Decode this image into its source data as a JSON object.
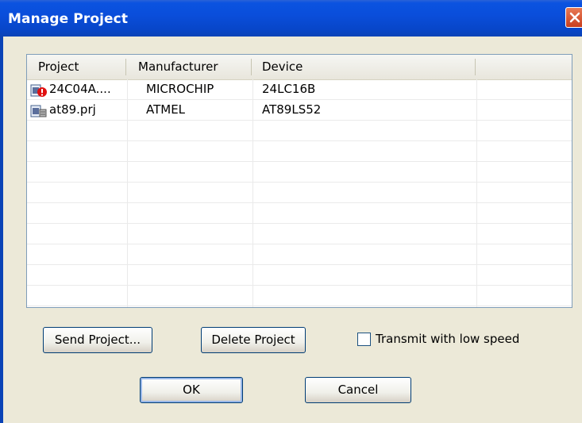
{
  "window": {
    "title": "Manage Project"
  },
  "table": {
    "columns": [
      "Project",
      "Manufacturer",
      "Device"
    ],
    "rows": [
      {
        "project": "24C04A....",
        "manufacturer": "MICROCHIP",
        "device": "24LC16B",
        "icon": "project-warning-icon"
      },
      {
        "project": "at89.prj",
        "manufacturer": "ATMEL",
        "device": "AT89LS52",
        "icon": "project-chip-icon"
      }
    ]
  },
  "buttons": {
    "send": "Send Project...",
    "delete": "Delete Project",
    "ok": "OK",
    "cancel": "Cancel"
  },
  "options": {
    "low_speed_label": "Transmit with low speed",
    "low_speed_checked": false
  },
  "colors": {
    "titlebar": "#0A4EDB",
    "face": "#ECE9D8",
    "close": "#D9542F"
  }
}
